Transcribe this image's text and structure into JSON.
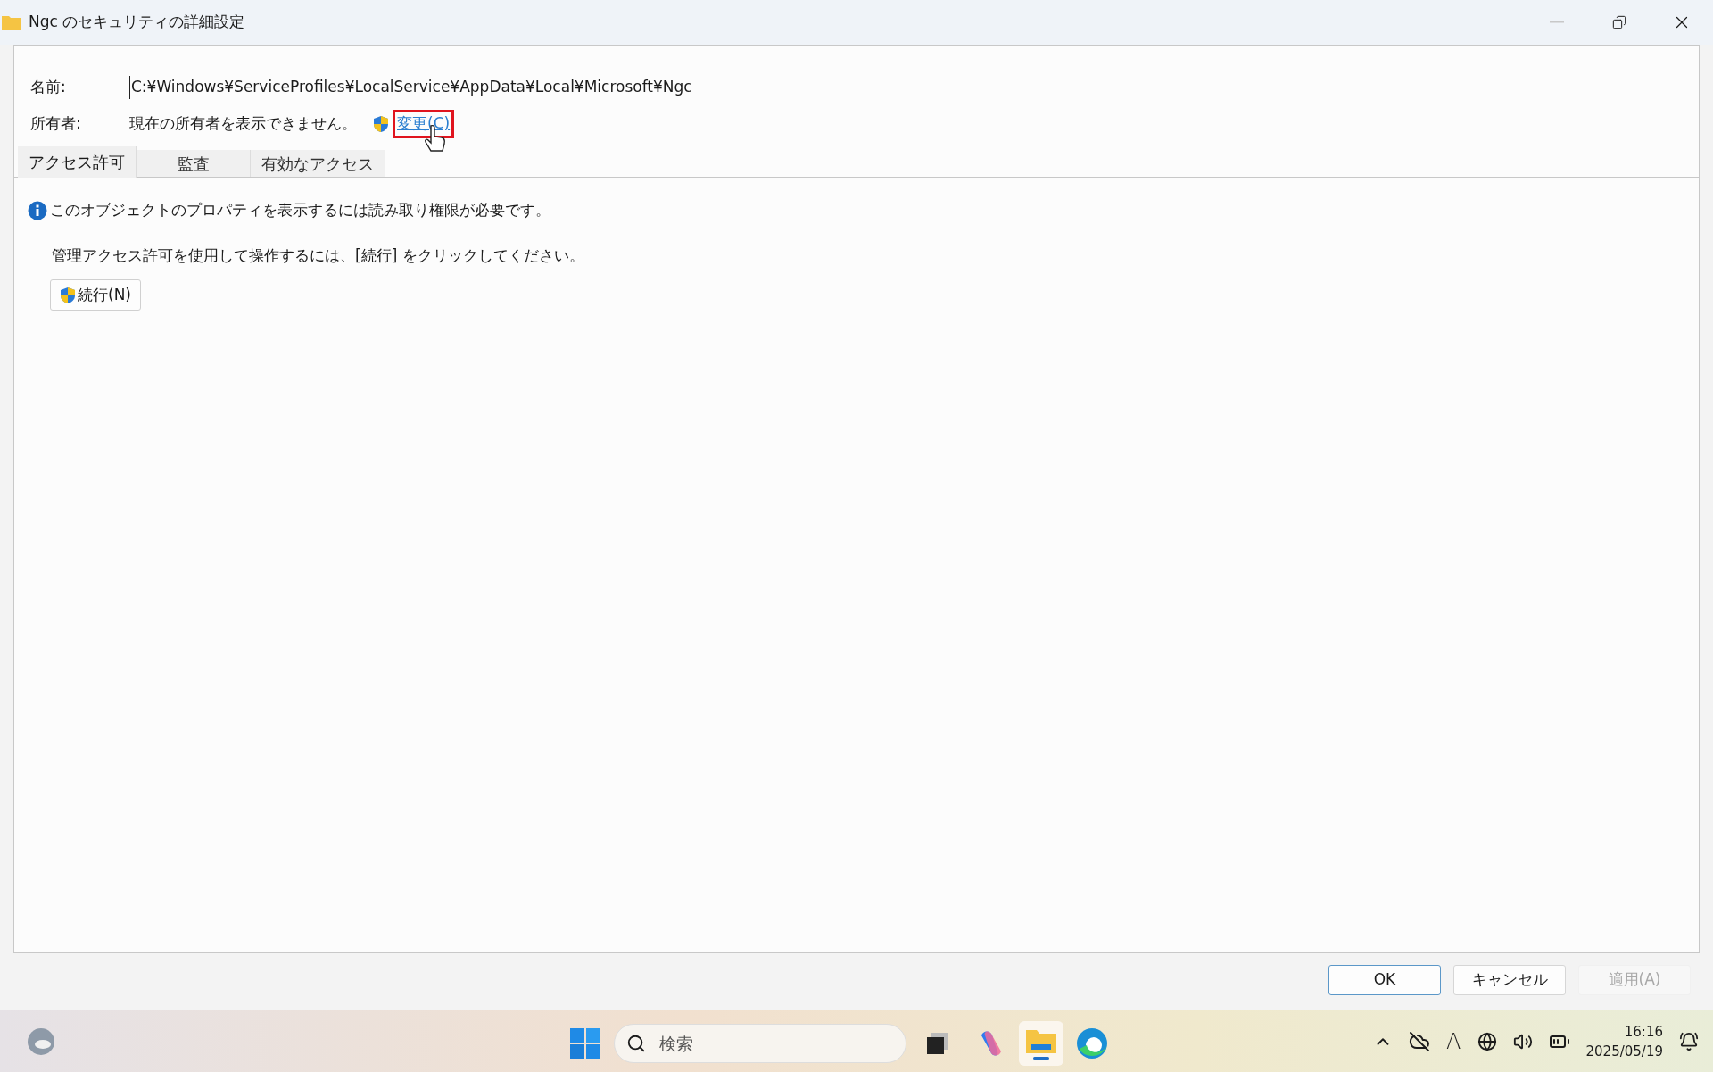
{
  "window": {
    "title": "Ngc のセキュリティの詳細設定",
    "minimize_disabled": true
  },
  "name_row": {
    "label": "名前:",
    "value": "C:¥Windows¥ServiceProfiles¥LocalService¥AppData¥Local¥Microsoft¥Ngc"
  },
  "owner_row": {
    "label": "所有者:",
    "value": "現在の所有者を表示できません。",
    "link": "変更(C)",
    "link_highlighted": true
  },
  "tabs": [
    {
      "label": "アクセス許可",
      "selected": true
    },
    {
      "label": "監査",
      "selected": false
    },
    {
      "label": "有効なアクセス",
      "selected": false
    }
  ],
  "info": {
    "message": "このオブジェクトのプロパティを表示するには読み取り権限が必要です。",
    "instruction": "管理アクセス許可を使用して操作するには、[続行] をクリックしてください。",
    "continue_button": "続行(N)"
  },
  "buttons": [
    {
      "label": "OK",
      "disabled": false,
      "default": true
    },
    {
      "label": "キャンセル",
      "disabled": false,
      "default": false
    },
    {
      "label": "適用(A)",
      "disabled": true,
      "default": false
    }
  ],
  "taskbar": {
    "search_placeholder": "検索",
    "ime_indicator": "A",
    "time": "16:16",
    "date": "2025/05/19"
  }
}
